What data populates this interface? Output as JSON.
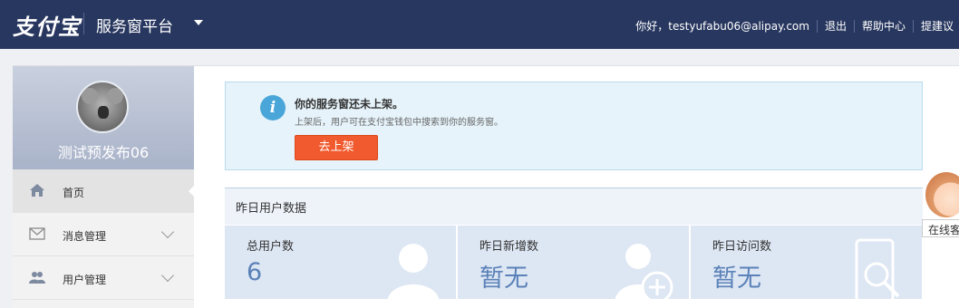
{
  "topbar": {
    "logo": "支付宝",
    "platform": "服务窗平台",
    "greeting": "你好，testyufabu06@alipay.com",
    "logout": "退出",
    "help": "帮助中心",
    "feedback": "提建议"
  },
  "sidebar": {
    "profile_name": "测试预发布06",
    "items": [
      {
        "label": "首页",
        "icon": "home-icon"
      },
      {
        "label": "消息管理",
        "icon": "mail-icon"
      },
      {
        "label": "用户管理",
        "icon": "users-icon"
      }
    ]
  },
  "notice": {
    "title": "你的服务窗还未上架。",
    "desc": "上架后，用户可在支付宝钱包中搜索到你的服务窗。",
    "button": "去上架"
  },
  "stats": {
    "header": "昨日用户数据",
    "cards": [
      {
        "label": "总用户数",
        "value": "6"
      },
      {
        "label": "昨日新增数",
        "value": "暂无"
      },
      {
        "label": "昨日访问数",
        "value": "暂无"
      }
    ]
  },
  "float": {
    "label": "在线客"
  },
  "colors": {
    "topbar": "#28375f",
    "accent_button": "#f05a2e",
    "stat_value": "#5b82b8"
  }
}
